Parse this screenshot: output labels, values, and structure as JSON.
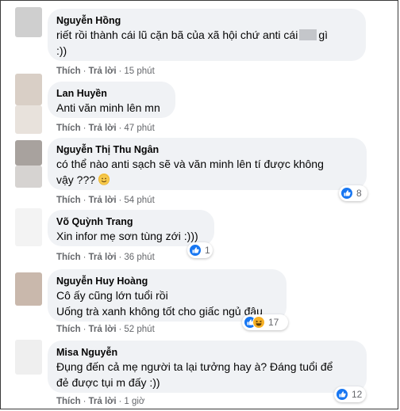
{
  "comments": [
    {
      "name": "Nguyễn Hồng",
      "lines": [
        "riết rồi thành cái lũ cặn bã của xã hội chứ anti cái",
        ":))"
      ],
      "line1_tail": "gì",
      "actions": {
        "like": "Thích",
        "reply": "Trả lời",
        "time": "15 phút"
      },
      "avatar_color": "#cfcfcf"
    },
    {
      "name": "Lan Huyền",
      "lines": [
        "Anti văn minh lên mn"
      ],
      "actions": {
        "like": "Thích",
        "reply": "Trả lời",
        "time": "47 phút"
      },
      "avatar_color": "#d9cfc6"
    },
    {
      "name": "Nguyễn Thị Thu Ngân",
      "lines": [
        "có thể nào anti sạch sẽ và văn minh lên tí được không",
        "vậy ???"
      ],
      "actions": {
        "like": "Thích",
        "reply": "Trả lời",
        "time": "54 phút"
      },
      "reactions": {
        "count": "8"
      },
      "avatar_color": "#a8a29e"
    },
    {
      "name": "Võ Quỳnh Trang",
      "lines": [
        "Xin infor mẹ sơn tùng zới :)))"
      ],
      "actions": {
        "like": "Thích",
        "reply": "Trả lời",
        "time": "36 phút"
      },
      "reactions": {
        "count": "1"
      },
      "avatar_color": "#f3f3f3"
    },
    {
      "name": "Nguyễn Huy Hoàng",
      "lines": [
        "Cô ấy cũng lớn tuổi rồi",
        "Uống trà xanh không tốt cho giấc ngủ đâu"
      ],
      "actions": {
        "like": "Thích",
        "reply": "Trả lời",
        "time": "52 phút"
      },
      "reactions": {
        "count": "17"
      },
      "avatar_color": "#c9b8ac"
    },
    {
      "name": "Misa Nguyễn",
      "lines": [
        "Đụng đến cả mẹ người ta lại tưởng hay à? Đáng tuổi để",
        "đẻ được tụi m đấy :))"
      ],
      "actions": {
        "like": "Thích",
        "reply": "Trả lời",
        "time": "1 giờ"
      },
      "reactions": {
        "count": "12"
      },
      "avatar_color": "#efefef"
    }
  ],
  "colors": {
    "bubble": "#f0f2f5",
    "like_blue": "#1877f2",
    "haha_yellow": "#f7b125",
    "meta_gray": "#65676b"
  },
  "icons": {
    "like": "like-icon",
    "haha": "haha-icon",
    "smile": "smile-emoji"
  }
}
